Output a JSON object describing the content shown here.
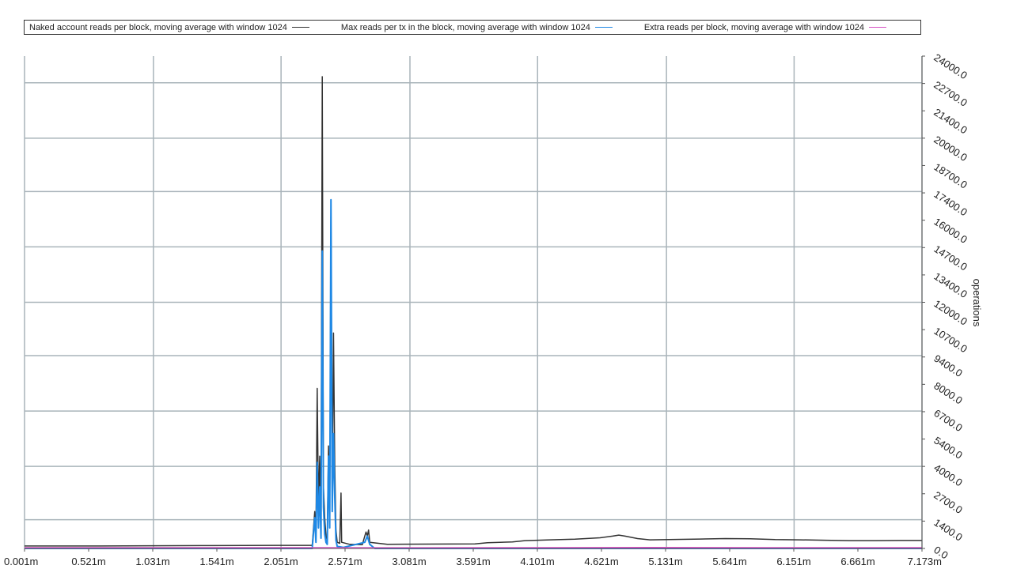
{
  "chart_data": {
    "type": "line",
    "title": "",
    "xlabel": "",
    "ylabel": "operations",
    "xlim": [
      0.001,
      7.173
    ],
    "ylim": [
      0,
      24000
    ],
    "x_unit": "m",
    "grid": true,
    "legend_position": "top",
    "x_ticks": [
      "0.001m",
      "0.521m",
      "1.031m",
      "1.541m",
      "2.051m",
      "2.571m",
      "3.081m",
      "3.591m",
      "4.101m",
      "4.621m",
      "5.131m",
      "5.641m",
      "6.151m",
      "6.661m",
      "7.173m"
    ],
    "x_grid_values": [
      0.001,
      1.031,
      2.051,
      3.081,
      4.101,
      5.131,
      6.151,
      7.173
    ],
    "y_ticks": [
      "0.0",
      "1400.0",
      "2700.0",
      "4000.0",
      "5400.0",
      "6700.0",
      "8000.0",
      "9400.0",
      "10700.0",
      "12000.0",
      "13400.0",
      "14700.0",
      "16000.0",
      "17400.0",
      "18700.0",
      "20000.0",
      "21400.0",
      "22700.0",
      "24000.0"
    ],
    "y_grid_values": [
      1400,
      4000,
      6700,
      9400,
      12000,
      14700,
      17400,
      20000,
      22700
    ],
    "series": [
      {
        "name": "Naked account reads per block, moving average with window 1024",
        "color": "#333333",
        "points": [
          [
            0.001,
            120
          ],
          [
            0.5,
            120
          ],
          [
            1.0,
            130
          ],
          [
            1.5,
            140
          ],
          [
            2.0,
            150
          ],
          [
            2.3,
            150
          ],
          [
            2.32,
            1800
          ],
          [
            2.33,
            600
          ],
          [
            2.34,
            7800
          ],
          [
            2.35,
            2000
          ],
          [
            2.36,
            4500
          ],
          [
            2.37,
            800
          ],
          [
            2.38,
            23000
          ],
          [
            2.39,
            3000
          ],
          [
            2.4,
            1500
          ],
          [
            2.41,
            600
          ],
          [
            2.42,
            400
          ],
          [
            2.43,
            5000
          ],
          [
            2.44,
            1200
          ],
          [
            2.45,
            16200
          ],
          [
            2.46,
            2500
          ],
          [
            2.47,
            10500
          ],
          [
            2.48,
            4000
          ],
          [
            2.49,
            900
          ],
          [
            2.5,
            300
          ],
          [
            2.52,
            250
          ],
          [
            2.53,
            2700
          ],
          [
            2.535,
            300
          ],
          [
            2.6,
            200
          ],
          [
            2.7,
            180
          ],
          [
            2.72,
            600
          ],
          [
            2.73,
            800
          ],
          [
            2.74,
            600
          ],
          [
            2.75,
            900
          ],
          [
            2.76,
            300
          ],
          [
            2.9,
            200
          ],
          [
            3.2,
            210
          ],
          [
            3.6,
            220
          ],
          [
            3.7,
            280
          ],
          [
            3.9,
            320
          ],
          [
            4.0,
            380
          ],
          [
            4.2,
            420
          ],
          [
            4.4,
            450
          ],
          [
            4.6,
            520
          ],
          [
            4.7,
            600
          ],
          [
            4.75,
            650
          ],
          [
            4.8,
            600
          ],
          [
            4.9,
            480
          ],
          [
            5.0,
            420
          ],
          [
            5.2,
            440
          ],
          [
            5.4,
            460
          ],
          [
            5.6,
            480
          ],
          [
            5.8,
            470
          ],
          [
            6.0,
            430
          ],
          [
            6.2,
            420
          ],
          [
            6.4,
            400
          ],
          [
            6.6,
            380
          ],
          [
            6.8,
            380
          ],
          [
            7.0,
            390
          ],
          [
            7.173,
            390
          ]
        ]
      },
      {
        "name": "Max reads per tx in the block, moving average with window 1024",
        "color": "#1e88e5",
        "points": [
          [
            0.001,
            0
          ],
          [
            2.3,
            0
          ],
          [
            2.32,
            1500
          ],
          [
            2.33,
            300
          ],
          [
            2.34,
            4200
          ],
          [
            2.35,
            1000
          ],
          [
            2.36,
            3000
          ],
          [
            2.37,
            500
          ],
          [
            2.38,
            14500
          ],
          [
            2.39,
            2000
          ],
          [
            2.4,
            700
          ],
          [
            2.41,
            300
          ],
          [
            2.42,
            200
          ],
          [
            2.43,
            4500
          ],
          [
            2.44,
            1000
          ],
          [
            2.45,
            17000
          ],
          [
            2.46,
            1800
          ],
          [
            2.47,
            5600
          ],
          [
            2.48,
            2500
          ],
          [
            2.49,
            400
          ],
          [
            2.5,
            100
          ],
          [
            2.55,
            50
          ],
          [
            2.72,
            300
          ],
          [
            2.74,
            600
          ],
          [
            2.76,
            200
          ],
          [
            2.8,
            0
          ],
          [
            7.173,
            0
          ]
        ]
      },
      {
        "name": "Extra reads per block, moving average with window 1024",
        "color": "#d64fc3",
        "points": [
          [
            0.001,
            40
          ],
          [
            2.0,
            40
          ],
          [
            3.0,
            35
          ],
          [
            4.0,
            40
          ],
          [
            5.0,
            45
          ],
          [
            6.0,
            40
          ],
          [
            7.173,
            40
          ]
        ]
      }
    ]
  }
}
